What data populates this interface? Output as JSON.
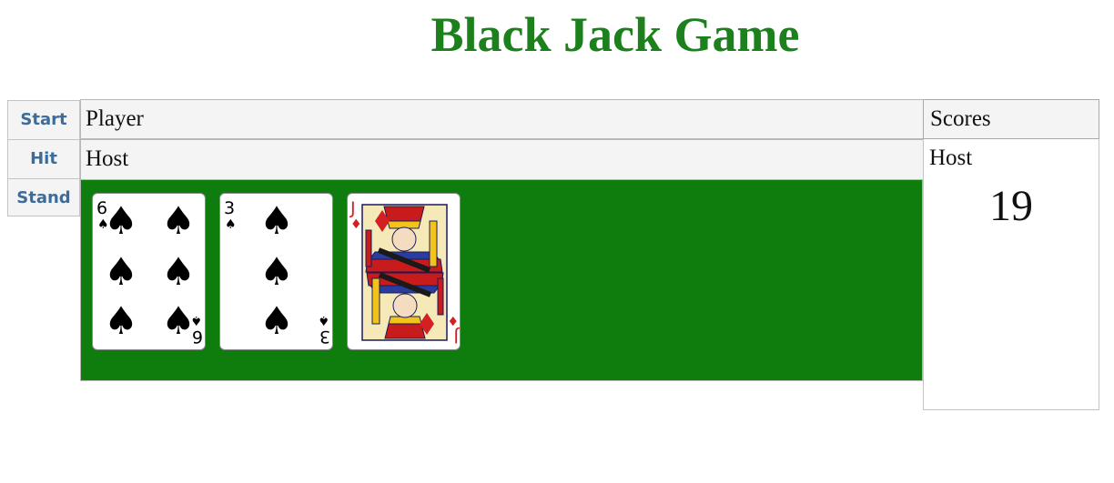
{
  "title": "Black Jack Game",
  "sidebar": {
    "start_label": "Start",
    "hit_label": "Hit",
    "stand_label": "Stand"
  },
  "tabs": {
    "player_label": "Player",
    "host_label": "Host"
  },
  "table": {
    "felt_color": "#0e7d0e",
    "cards": [
      {
        "rank": "6",
        "suit": "spades",
        "color": "#000000"
      },
      {
        "rank": "3",
        "suit": "spades",
        "color": "#000000"
      },
      {
        "rank": "J",
        "suit": "diamonds",
        "color": "#d42020"
      }
    ]
  },
  "scores": {
    "header": "Scores",
    "label": "Host",
    "value": "19"
  },
  "colors": {
    "title": "#1c801c",
    "button_text": "#3e6c9a",
    "tab_bg": "#f4f4f4"
  }
}
